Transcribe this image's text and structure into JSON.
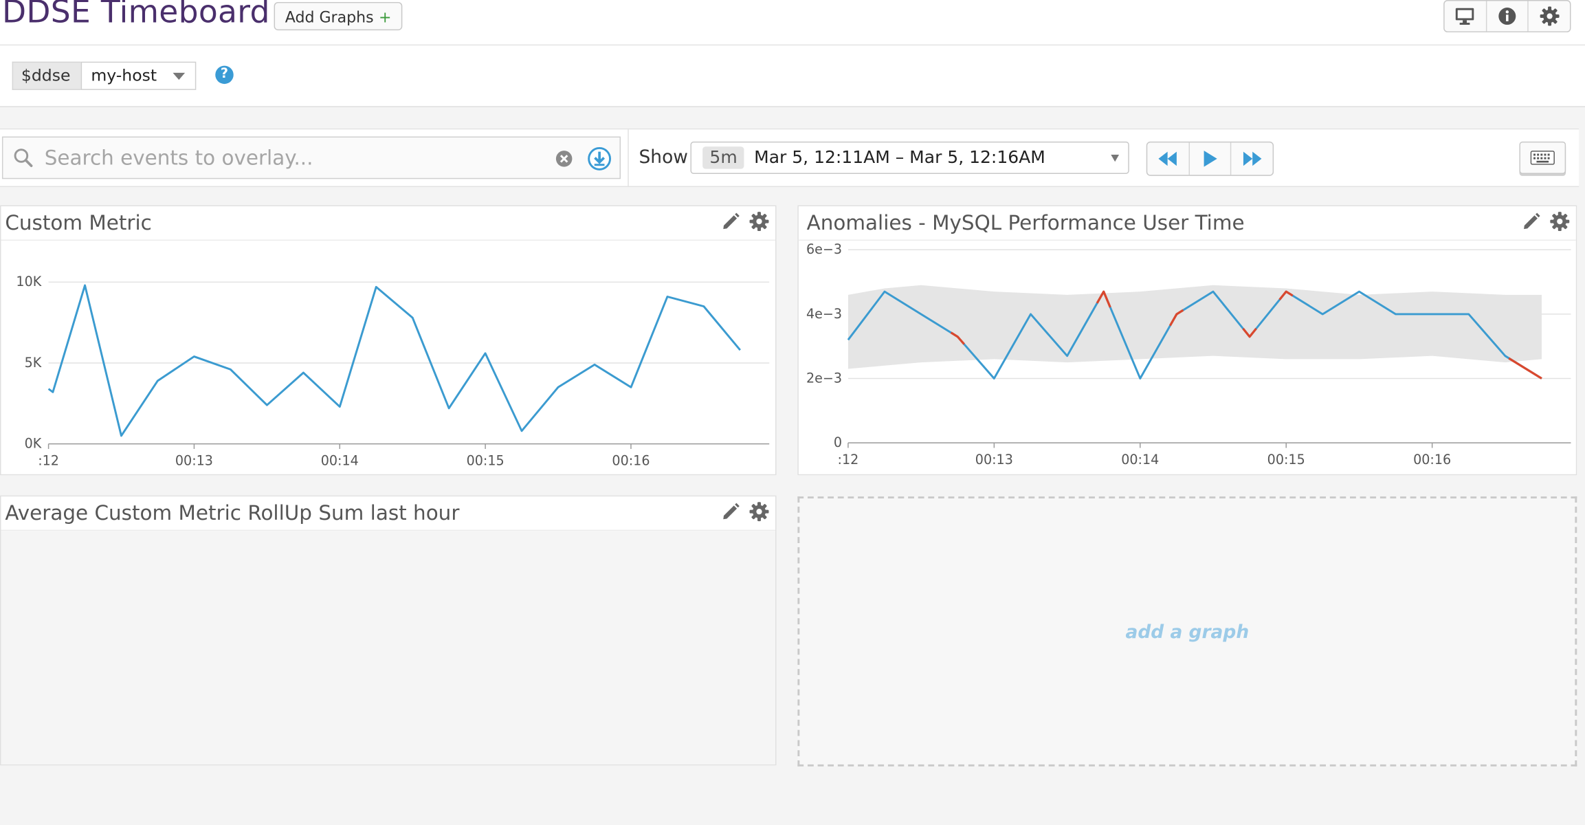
{
  "header": {
    "title": "DDSE Timeboard",
    "add_graphs_label": "Add Graphs",
    "add_graphs_plus": "+",
    "icons": [
      "monitor-icon",
      "info-icon",
      "gear-icon"
    ]
  },
  "template_vars": {
    "name": "$ddse",
    "value": "my-host",
    "help_label": "?"
  },
  "controls": {
    "search_placeholder": "Search events to overlay...",
    "show_label": "Show",
    "range_badge": "5m",
    "range_text": "Mar 5, 12:11AM – Mar 5, 12:16AM",
    "playback": [
      "rewind-icon",
      "play-icon",
      "fast-forward-icon"
    ],
    "keyboard_icon": "keyboard-icon"
  },
  "colors": {
    "title": "#4a2f6c",
    "line": "#3b9bd0",
    "anomaly": "#d9482e",
    "band": "#e5e5e5",
    "add_graph_text": "#9ccbe8"
  },
  "panels": {
    "custom_metric": {
      "title": "Custom Metric"
    },
    "anomalies": {
      "title": "Anomalies - MySQL Performance User Time"
    },
    "rollup": {
      "title": "Average Custom Metric RollUp Sum last hour"
    },
    "add_graph_label": "add a graph"
  },
  "chart_data": [
    {
      "type": "line",
      "title": "Custom Metric",
      "x_ticks": [
        ":12",
        "00:13",
        "00:14",
        "00:15",
        "00:16"
      ],
      "y_ticks": [
        "0K",
        "5K",
        "10K"
      ],
      "ylim": [
        0,
        10000
      ],
      "xlim": [
        12.0,
        16.95
      ],
      "grid": true,
      "series": [
        {
          "x": [
            12.0,
            12.03,
            12.25,
            12.5,
            12.75,
            13.0,
            13.25,
            13.5,
            13.75,
            14.0,
            14.25,
            14.5,
            14.75,
            15.0,
            15.25,
            15.5,
            15.75,
            16.0,
            16.25,
            16.5,
            16.75
          ],
          "values": [
            3400,
            3200,
            9800,
            500,
            3900,
            5400,
            4600,
            2400,
            4400,
            2300,
            9700,
            7800,
            2200,
            5600,
            800,
            3500,
            4900,
            3500,
            9100,
            8500,
            5800
          ]
        }
      ]
    },
    {
      "type": "line",
      "title": "Anomalies - MySQL Performance User Time",
      "x_ticks": [
        ":12",
        "00:13",
        "00:14",
        "00:15",
        "00:16"
      ],
      "y_ticks": [
        "0",
        "2e−3",
        "4e−3",
        "6e−3"
      ],
      "ylim": [
        0,
        0.006
      ],
      "xlim": [
        12.0,
        16.95
      ],
      "grid": true,
      "band": {
        "x": [
          12.0,
          12.25,
          12.5,
          13.0,
          13.5,
          14.0,
          14.5,
          15.0,
          15.5,
          16.0,
          16.5,
          16.75
        ],
        "upper": [
          0.0046,
          0.0048,
          0.0049,
          0.0047,
          0.0046,
          0.0047,
          0.0049,
          0.0048,
          0.0046,
          0.0047,
          0.0046,
          0.0046
        ],
        "lower": [
          0.0023,
          0.0024,
          0.0025,
          0.0026,
          0.0025,
          0.0026,
          0.0027,
          0.0026,
          0.0026,
          0.0027,
          0.0025,
          0.0026
        ]
      },
      "series": [
        {
          "name": "",
          "x": [
            12.0,
            12.25,
            12.5,
            12.75,
            13.0,
            13.25,
            13.5,
            13.75,
            14.0,
            14.25,
            14.5,
            14.75,
            15.0,
            15.25,
            15.5,
            15.75,
            16.0,
            16.25,
            16.5,
            16.75
          ],
          "values": [
            0.0032,
            0.0047,
            0.004,
            0.0033,
            0.002,
            0.004,
            0.0027,
            0.0047,
            0.002,
            0.004,
            0.0047,
            0.0033,
            0.0047,
            0.004,
            0.0047,
            0.004,
            0.004,
            0.004,
            0.0027,
            0.002
          ],
          "anomalies": [
            3,
            7,
            9,
            11,
            12,
            19
          ]
        }
      ]
    }
  ]
}
